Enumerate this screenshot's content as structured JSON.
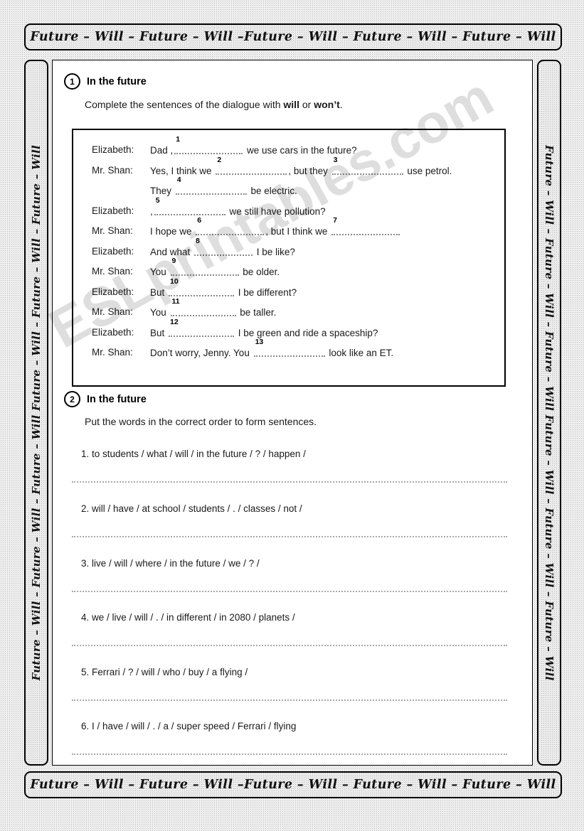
{
  "banners": {
    "top": "Future – Will – Future – Will –Future – Will – Future – Will – Future – Will",
    "bottom": "Future – Will – Future – Will –Future – Will – Future – Will – Future – Will",
    "left": "Future – Will – Future – Will – Future – Will Future – Will – Future – Will – Future – Will",
    "right": "Future – Will – Future – Will – Future – Will Future – Will – Future – Will – Future – Will"
  },
  "watermark": "ESLprintables.com",
  "exercise1": {
    "number": "1",
    "title": "In the future",
    "instruction_before": "Complete the sentences of the dialogue with ",
    "instruction_bold1": "will",
    "instruction_middle": " or ",
    "instruction_bold2": "won’t",
    "instruction_after": ".",
    "dialogue": [
      {
        "speaker": "Elizabeth:",
        "before": "Dad ,",
        "blank": "1",
        "after": " we use cars in the future?"
      },
      {
        "speaker": "Mr. Shan:",
        "before": "Yes, I think we ",
        "blank": "2",
        "after": ", but they ",
        "blank2": "3",
        "after2": " use petrol."
      },
      {
        "speaker": "",
        "before": "They ",
        "blank": "4",
        "after": " be electric."
      },
      {
        "speaker": "Elizabeth:",
        "before": ",",
        "blank": "5",
        "after": " we still have pollution?"
      },
      {
        "speaker": "Mr. Shan:",
        "before": "I hope we ",
        "blank": "6",
        "after": ", but I think we ",
        "blank2": "7",
        "after2": ""
      },
      {
        "speaker": "Elizabeth:",
        "before": "And what ",
        "blank": "8",
        "after": " I be like?"
      },
      {
        "speaker": "Mr. Shan:",
        "before": "You ",
        "blank": "9",
        "after": " be older."
      },
      {
        "speaker": "Elizabeth:",
        "before": "But ",
        "blank": "10",
        "after": " I be different?"
      },
      {
        "speaker": "Mr. Shan:",
        "before": "You ",
        "blank": "11",
        "after": " be taller."
      },
      {
        "speaker": "Elizabeth:",
        "before": "But ",
        "blank": "12",
        "after": " I be green and ride a spaceship?"
      },
      {
        "speaker": "Mr. Shan:",
        "before": "Don’t worry, Jenny. You ",
        "blank": "13",
        "after": " look like an ET."
      }
    ]
  },
  "exercise2": {
    "number": "2",
    "title": "In the future",
    "instruction": "Put the words in the correct order to form sentences.",
    "items": [
      "1.  to students  /  what  / will  / in the future  / ? / happen /",
      "2.  will  /  have  /  at school  /  students  / .  / classes  / not /",
      "3.  live  /  will  / where  /  in the future  / we  / ? /",
      "4.  we  / live  /  will  /  .  / in different  /  in 2080  / planets  /",
      "5.  Ferrari / ?  /  will  / who /  buy  / a flying /",
      "6.  I  / have  /  will  /  .  / a  /  super speed / Ferrari  /  flying"
    ]
  }
}
